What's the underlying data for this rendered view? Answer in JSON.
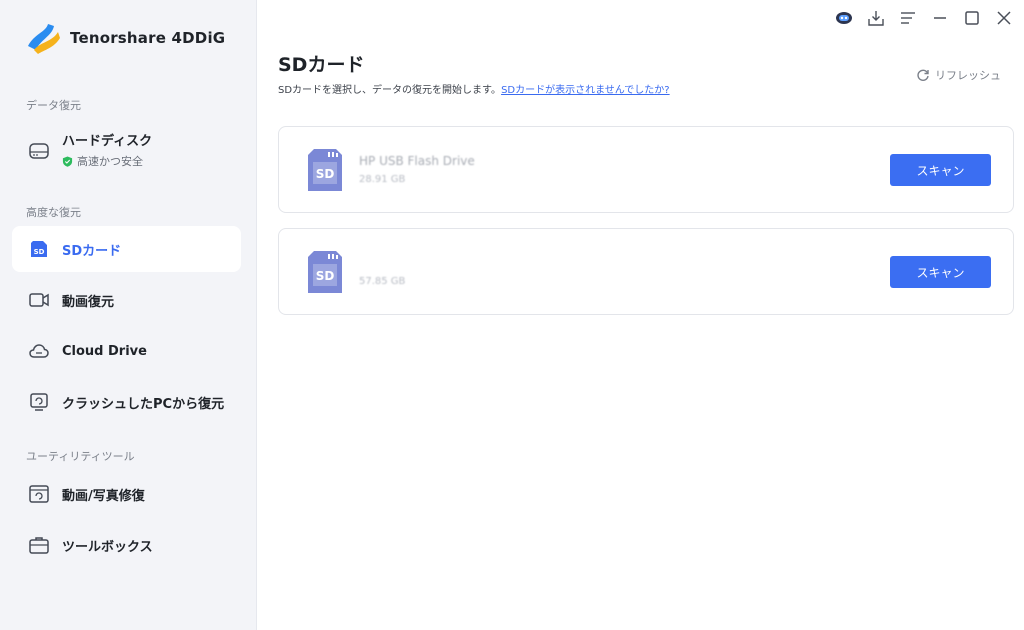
{
  "app": {
    "name": "Tenorshare 4DDiG"
  },
  "sidebar": {
    "sections": [
      {
        "label": "データ復元"
      },
      {
        "label": "高度な復元"
      },
      {
        "label": "ユーティリティツール"
      }
    ],
    "hard_disk": {
      "label": "ハードディスク",
      "sub": "高速かつ安全"
    },
    "items": [
      {
        "label": "SDカード"
      },
      {
        "label": "動画復元"
      },
      {
        "label": "Cloud Drive"
      },
      {
        "label": "クラッシュしたPCから復元"
      },
      {
        "label": "動画/写真修復"
      },
      {
        "label": "ツールボックス"
      }
    ],
    "active_item": "SDカード"
  },
  "main": {
    "title": "SDカード",
    "description": "SDカードを選択し、データの復元を開始します。",
    "help_link": "SDカードが表示されませんでしたか?",
    "refresh_label": "リフレッシュ",
    "drives": [
      {
        "name": "HP USB Flash Drive",
        "size": "28.91 GB",
        "icon_label": "SD",
        "button": "スキャン"
      },
      {
        "name": "",
        "size": "57.85 GB",
        "icon_label": "SD",
        "button": "スキャン"
      }
    ]
  },
  "colors": {
    "accent": "#3b6ef2",
    "sidebar_bg": "#f3f4f8",
    "sd_icon": "#7b88d6",
    "safe_green": "#2dbb5e"
  },
  "icons": {
    "window_controls": [
      "robot-icon",
      "download-icon",
      "menu-icon",
      "minimize-icon",
      "maximize-icon",
      "close-icon"
    ]
  }
}
